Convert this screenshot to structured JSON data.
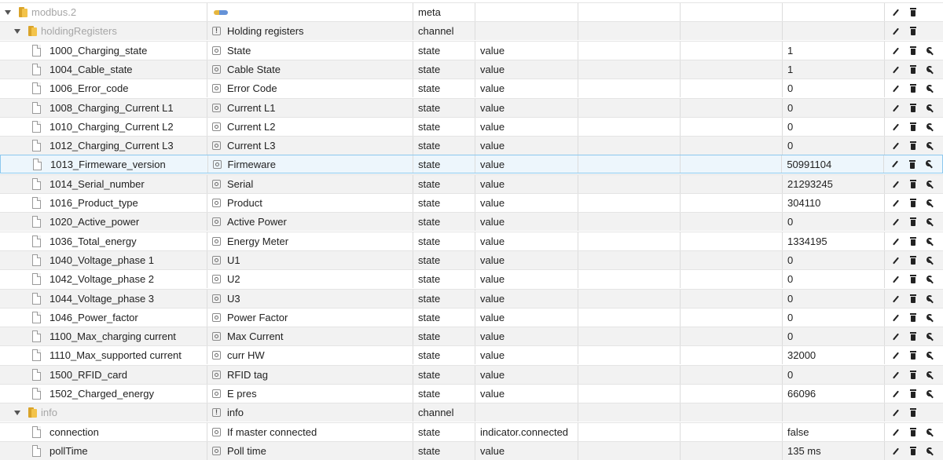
{
  "rows": [
    {
      "id": "modbus.2",
      "kind": "folder",
      "depth": 0,
      "expanded": true,
      "muted": true,
      "name": "",
      "name_icon": "logo",
      "type": "meta",
      "role": "",
      "value": "",
      "wrench": false
    },
    {
      "id": "holdingRegisters",
      "kind": "folder",
      "depth": 1,
      "expanded": true,
      "muted": true,
      "name": "Holding registers",
      "name_icon": "channel",
      "type": "channel",
      "role": "",
      "value": "",
      "wrench": false
    },
    {
      "id": "1000_Charging_state",
      "kind": "state",
      "depth": 2,
      "name": "State",
      "name_icon": "state",
      "type": "state",
      "role": "value",
      "value": "1",
      "wrench": true
    },
    {
      "id": "1004_Cable_state",
      "kind": "state",
      "depth": 2,
      "name": "Cable State",
      "name_icon": "state",
      "type": "state",
      "role": "value",
      "value": "1",
      "wrench": true
    },
    {
      "id": "1006_Error_code",
      "kind": "state",
      "depth": 2,
      "name": "Error Code",
      "name_icon": "state",
      "type": "state",
      "role": "value",
      "value": "0",
      "wrench": true
    },
    {
      "id": "1008_Charging_Current L1",
      "kind": "state",
      "depth": 2,
      "name": "Current L1",
      "name_icon": "state",
      "type": "state",
      "role": "value",
      "value": "0",
      "wrench": true
    },
    {
      "id": "1010_Charging_Current L2",
      "kind": "state",
      "depth": 2,
      "name": "Current L2",
      "name_icon": "state",
      "type": "state",
      "role": "value",
      "value": "0",
      "wrench": true
    },
    {
      "id": "1012_Charging_Current L3",
      "kind": "state",
      "depth": 2,
      "name": "Current L3",
      "name_icon": "state",
      "type": "state",
      "role": "value",
      "value": "0",
      "wrench": true
    },
    {
      "id": "1013_Firmeware_version",
      "kind": "state",
      "depth": 2,
      "selected": true,
      "name": "Firmeware",
      "name_icon": "state",
      "type": "state",
      "role": "value",
      "value": "50991104",
      "wrench": true
    },
    {
      "id": "1014_Serial_number",
      "kind": "state",
      "depth": 2,
      "name": "Serial",
      "name_icon": "state",
      "type": "state",
      "role": "value",
      "value": "21293245",
      "wrench": true
    },
    {
      "id": "1016_Product_type",
      "kind": "state",
      "depth": 2,
      "name": "Product",
      "name_icon": "state",
      "type": "state",
      "role": "value",
      "value": "304110",
      "wrench": true
    },
    {
      "id": "1020_Active_power",
      "kind": "state",
      "depth": 2,
      "name": "Active Power",
      "name_icon": "state",
      "type": "state",
      "role": "value",
      "value": "0",
      "wrench": true
    },
    {
      "id": "1036_Total_energy",
      "kind": "state",
      "depth": 2,
      "name": "Energy Meter",
      "name_icon": "state",
      "type": "state",
      "role": "value",
      "value": "1334195",
      "wrench": true
    },
    {
      "id": "1040_Voltage_phase 1",
      "kind": "state",
      "depth": 2,
      "name": "U1",
      "name_icon": "state",
      "type": "state",
      "role": "value",
      "value": "0",
      "wrench": true
    },
    {
      "id": "1042_Voltage_phase 2",
      "kind": "state",
      "depth": 2,
      "name": "U2",
      "name_icon": "state",
      "type": "state",
      "role": "value",
      "value": "0",
      "wrench": true
    },
    {
      "id": "1044_Voltage_phase 3",
      "kind": "state",
      "depth": 2,
      "name": "U3",
      "name_icon": "state",
      "type": "state",
      "role": "value",
      "value": "0",
      "wrench": true
    },
    {
      "id": "1046_Power_factor",
      "kind": "state",
      "depth": 2,
      "name": "Power Factor",
      "name_icon": "state",
      "type": "state",
      "role": "value",
      "value": "0",
      "wrench": true
    },
    {
      "id": "1100_Max_charging current",
      "kind": "state",
      "depth": 2,
      "name": "Max Current",
      "name_icon": "state",
      "type": "state",
      "role": "value",
      "value": "0",
      "wrench": true
    },
    {
      "id": "1110_Max_supported current",
      "kind": "state",
      "depth": 2,
      "name": "curr HW",
      "name_icon": "state",
      "type": "state",
      "role": "value",
      "value": "32000",
      "wrench": true
    },
    {
      "id": "1500_RFID_card",
      "kind": "state",
      "depth": 2,
      "name": "RFID tag",
      "name_icon": "state",
      "type": "state",
      "role": "value",
      "value": "0",
      "wrench": true
    },
    {
      "id": "1502_Charged_energy",
      "kind": "state",
      "depth": 2,
      "name": "E pres",
      "name_icon": "state",
      "type": "state",
      "role": "value",
      "value": "66096",
      "wrench": true
    },
    {
      "id": "info",
      "kind": "folder",
      "depth": 1,
      "expanded": true,
      "muted": true,
      "name": "info",
      "name_icon": "channel",
      "type": "channel",
      "role": "",
      "value": "",
      "wrench": false
    },
    {
      "id": "connection",
      "kind": "state",
      "depth": 2,
      "name": "If master connected",
      "name_icon": "state",
      "type": "state",
      "role": "indicator.connected",
      "value": "false",
      "wrench": true
    },
    {
      "id": "pollTime",
      "kind": "state",
      "depth": 2,
      "name": "Poll time",
      "name_icon": "state",
      "type": "state",
      "role": "value",
      "value": "135 ms",
      "wrench": true
    }
  ]
}
